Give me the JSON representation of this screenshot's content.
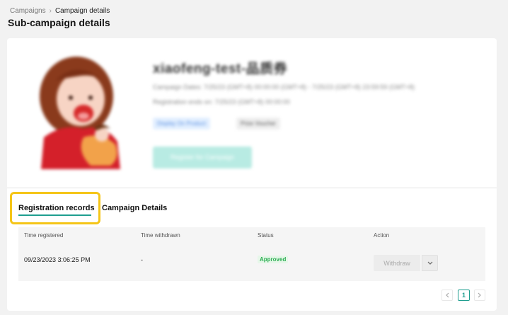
{
  "breadcrumb": {
    "parent": "Campaigns",
    "separator": "›",
    "current": "Campaign details"
  },
  "page_title": "Sub-campaign details",
  "hero": {
    "name": "xiaofeng-test-品质券",
    "line1": "Campaign Dates: 7/25/23 (GMT+8) 00:00:00 (GMT+8) - 7/25/23 (GMT+8) 23:59:59 (GMT+8)",
    "line2": "Registration ends on: 7/25/23 (GMT+8) 00:00:00",
    "tag_blue": "Display On Product",
    "tag_grey": "Prize Voucher",
    "button": "Register for Campaign"
  },
  "tabs": [
    {
      "label": "Registration records",
      "active": true
    },
    {
      "label": "Campaign Details",
      "active": false
    }
  ],
  "table": {
    "headers": [
      "Time registered",
      "Time withdrawn",
      "Status",
      "Action"
    ],
    "rows": [
      {
        "registered": "09/23/2023 3:06:25 PM",
        "withdrawn": "-",
        "status": "Approved",
        "action": "Withdraw"
      }
    ]
  },
  "pagination": {
    "current_page": "1"
  },
  "colors": {
    "accent": "#1f9e8f",
    "highlight": "#f5c518",
    "approved": "#2cae53"
  }
}
